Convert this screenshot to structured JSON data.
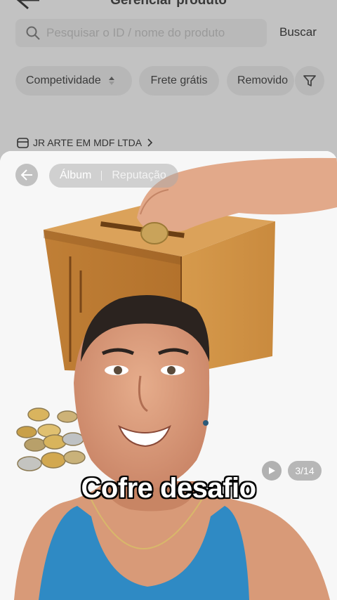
{
  "header": {
    "title": "Gerenciar produto"
  },
  "search": {
    "placeholder": "Pesquisar o ID / nome do produto",
    "button_label": "Buscar"
  },
  "filters": {
    "competitividade": "Competividade",
    "frete": "Frete grátis",
    "removido": "Removido"
  },
  "store": {
    "name": "JR ARTE EM MDF LTDA"
  },
  "viewer": {
    "tab_album": "Álbum",
    "tab_reputacao": "Reputação",
    "counter": "3/14",
    "caption": "Cofre desafio"
  },
  "colors": {
    "wood": "#c8893e",
    "wood_dark": "#8a5420",
    "skin": "#d99a78",
    "tank": "#2f8ac4"
  }
}
